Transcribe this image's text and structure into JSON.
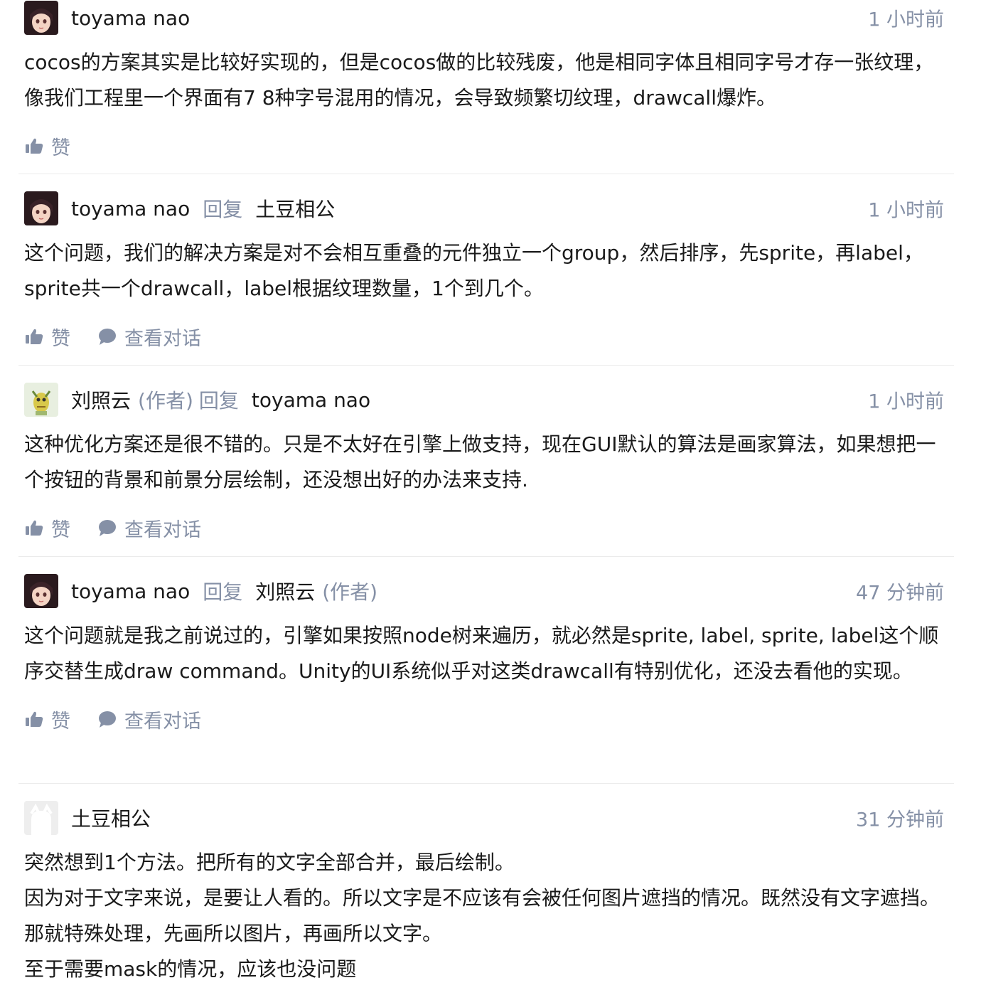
{
  "comments": [
    {
      "author": "toyama nao",
      "avatar_icon": "anime-girl-avatar",
      "time": "1 小时前",
      "paragraphs": [
        "cocos的方案其实是比较好实现的，但是cocos做的比较残废，他是相同字体且相同字号才存一张纹理，像我们工程里一个界面有7 8种字号混用的情况，会导致频繁切纹理，drawcall爆炸。"
      ],
      "like_label": "赞"
    },
    {
      "author": "toyama nao",
      "avatar_icon": "anime-girl-avatar",
      "reply_word": "回复",
      "reply_to": "土豆相公",
      "time": "1 小时前",
      "paragraphs": [
        "这个问题，我们的解决方案是对不会相互重叠的元件独立一个group，然后排序，先sprite，再label，sprite共一个drawcall，label根据纹理数量，1个到几个。"
      ],
      "like_label": "赞",
      "conversation_label": "查看对话"
    },
    {
      "author": "刘照云",
      "author_tag": "(作者)",
      "avatar_icon": "cartoon-creature-avatar",
      "reply_word": "回复",
      "reply_to": "toyama nao",
      "time": "1 小时前",
      "paragraphs": [
        "这种优化方案还是很不错的。只是不太好在引擎上做支持，现在GUI默认的算法是画家算法，如果想把一个按钮的背景和前景分层绘制，还没想出好的办法来支持."
      ],
      "like_label": "赞",
      "conversation_label": "查看对话"
    },
    {
      "author": "toyama nao",
      "avatar_icon": "anime-girl-avatar",
      "reply_word": "回复",
      "reply_to": "刘照云",
      "reply_to_tag": "(作者)",
      "time": "47 分钟前",
      "paragraphs": [
        "这个问题就是我之前说过的，引擎如果按照node树来遍历，就必然是sprite, label, sprite, label这个顺序交替生成draw command。Unity的UI系统似乎对这类drawcall有特别优化，还没去看他的实现。"
      ],
      "like_label": "赞",
      "conversation_label": "查看对话"
    },
    {
      "author": "土豆相公",
      "avatar_icon": "default-gray-avatar",
      "time": "31 分钟前",
      "paragraphs": [
        "突然想到1个方法。把所有的文字全部合并，最后绘制。",
        "因为对于文字来说，是要让人看的。所以文字是不应该有会被任何图片遮挡的情况。既然没有文字遮挡。那就特殊处理，先画所以图片，再画所以文字。",
        "至于需要mask的情况，应该也没问题"
      ]
    }
  ],
  "colors": {
    "text": "#1a1a1a",
    "meta": "#8590a6",
    "divider": "#ebebeb"
  }
}
